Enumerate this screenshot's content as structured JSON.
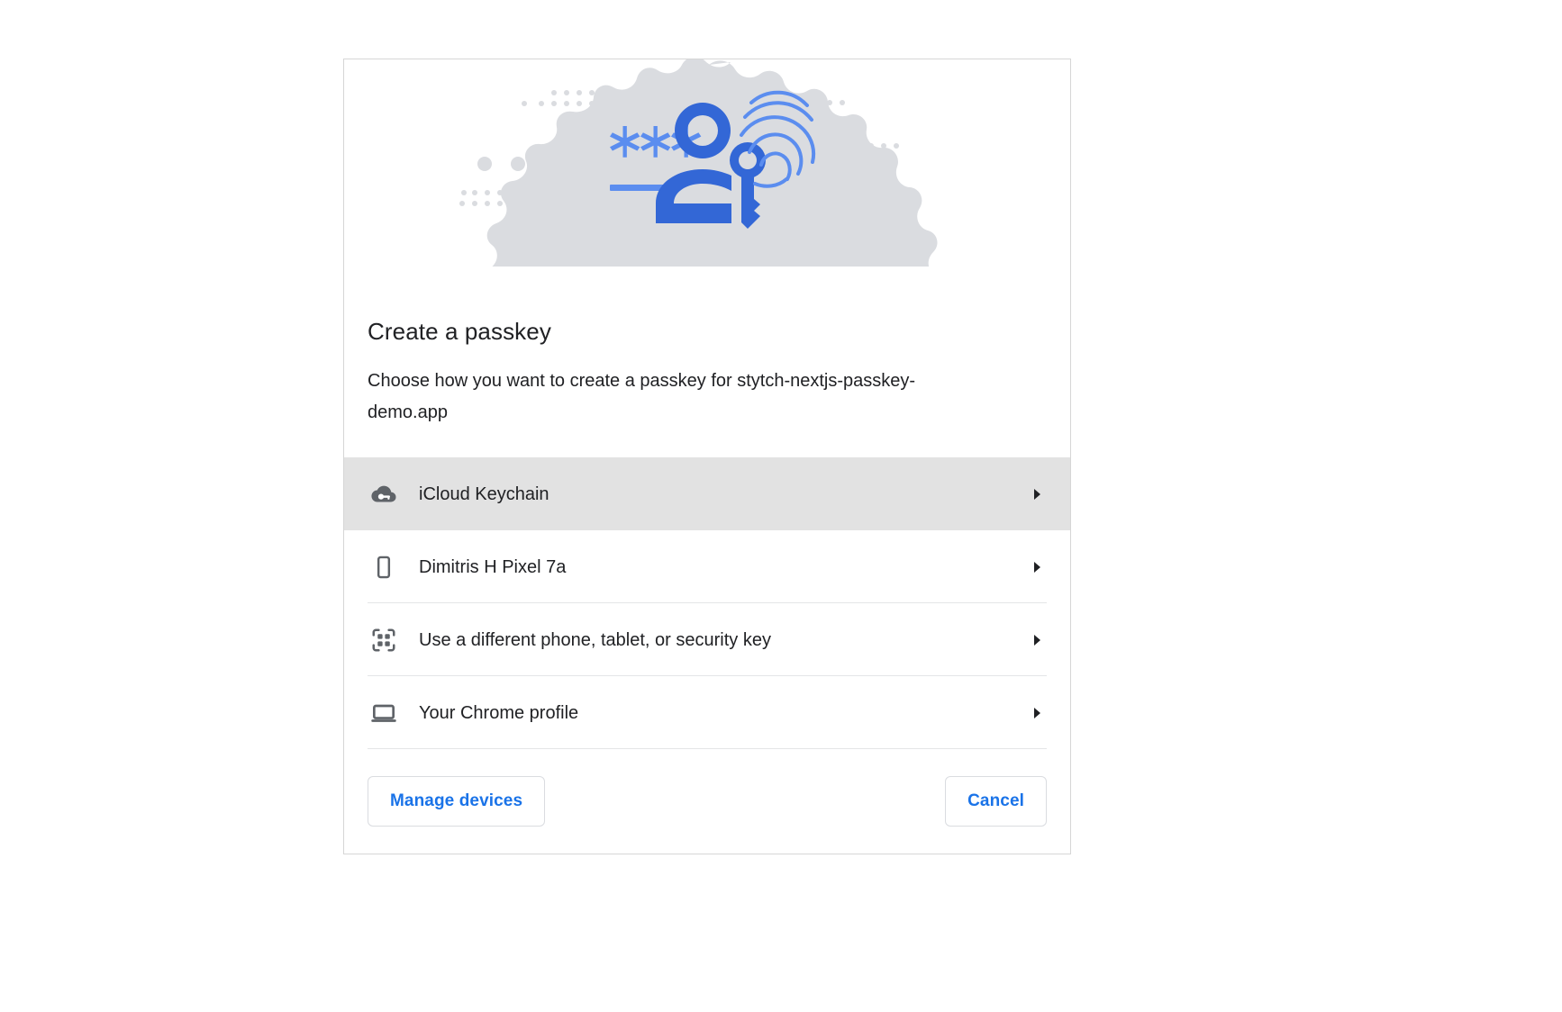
{
  "dialog": {
    "title": "Create a passkey",
    "subtitle": "Choose how you want to create a passkey for stytch-nextjs-passkey-demo.app",
    "options": [
      {
        "label": "iCloud Keychain",
        "icon": "cloud-key-icon",
        "selected": true,
        "chevron": "chevron-right-icon"
      },
      {
        "label": "Dimitris H Pixel 7a",
        "icon": "smartphone-icon",
        "selected": false,
        "chevron": "chevron-right-icon"
      },
      {
        "label": "Use a different phone, tablet, or security key",
        "icon": "qr-code-icon",
        "selected": false,
        "chevron": "chevron-right-icon"
      },
      {
        "label": "Your Chrome profile",
        "icon": "laptop-icon",
        "selected": false,
        "chevron": "chevron-right-icon"
      }
    ],
    "buttons": {
      "manage_devices": "Manage devices",
      "cancel": "Cancel"
    },
    "illustration": {
      "name": "passkey-hero-illustration",
      "blob_color": "#dadce0",
      "primary_color": "#3367d6",
      "accent_color": "#5b8def",
      "dot_color": "#dadce0"
    },
    "colors": {
      "accent": "#1a73e8",
      "selected_row_bg": "#e2e2e2",
      "text": "#202124",
      "icon": "#5f6368",
      "divider": "#e4e5e7",
      "border": "#d6d6d6"
    }
  }
}
